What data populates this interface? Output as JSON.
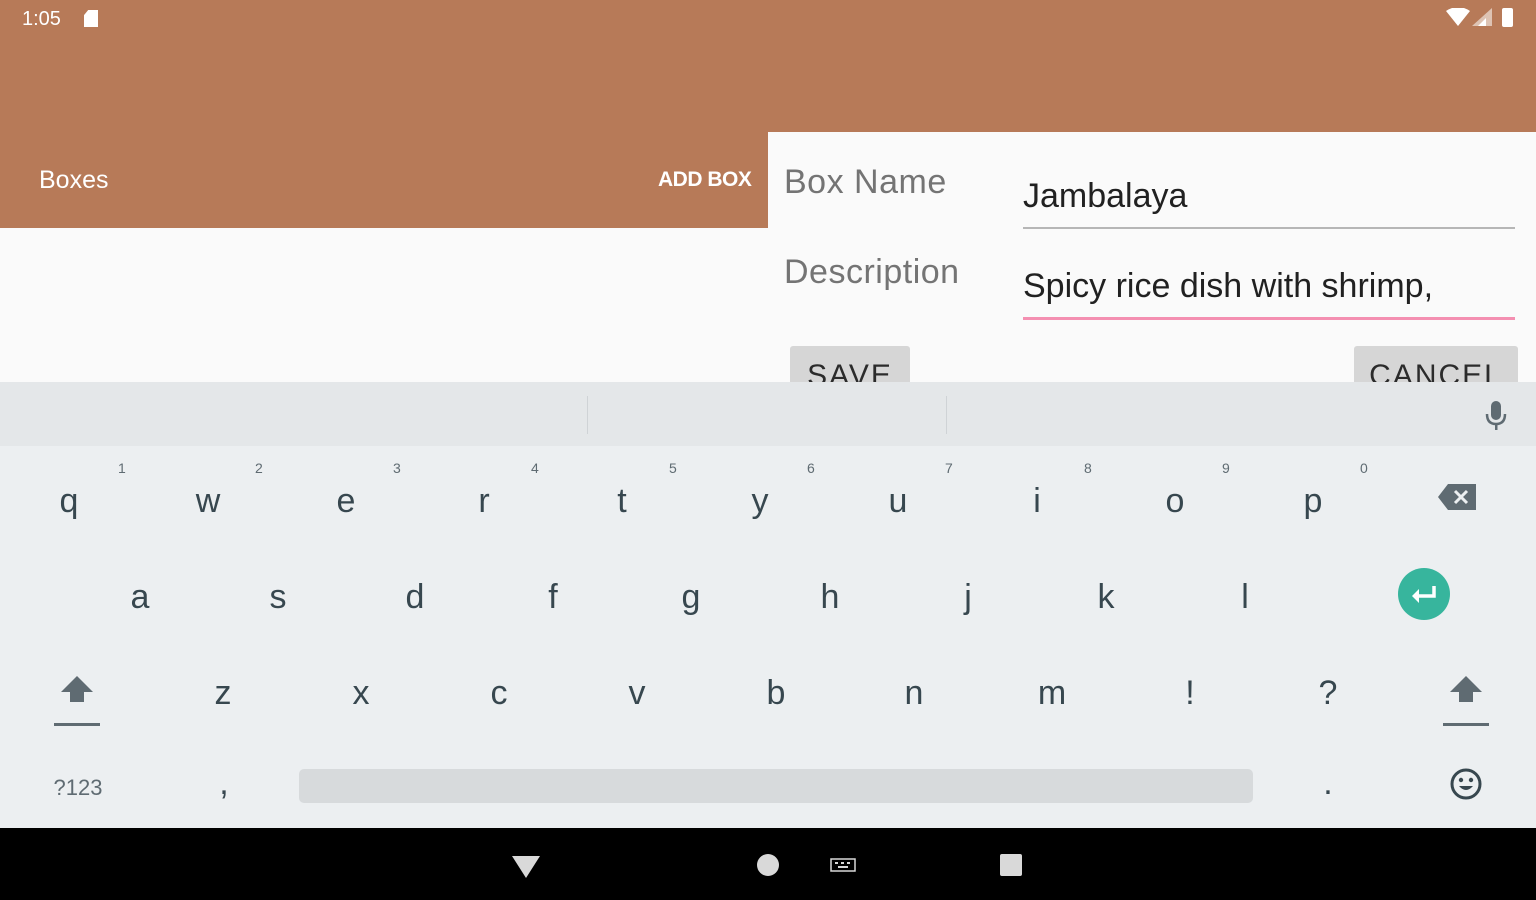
{
  "status_bar": {
    "time": "1:05",
    "icons": [
      "sd-card-icon",
      "wifi-icon",
      "signal-icon",
      "battery-icon"
    ]
  },
  "toolbar": {
    "title": "Boxes",
    "add_box_label": "ADD BOX",
    "color": "#b77a58"
  },
  "dialog": {
    "name_label": "Box Name",
    "name_value": "Jambalaya",
    "description_label": "Description",
    "description_value": "Spicy rice dish with shrimp,",
    "save_label": "SAVE",
    "cancel_label": "CANCEL",
    "active_underline_color": "#f48fb1"
  },
  "keyboard": {
    "row1": [
      "q",
      "w",
      "e",
      "r",
      "t",
      "y",
      "u",
      "i",
      "o",
      "p"
    ],
    "row1_hints": [
      "1",
      "2",
      "3",
      "4",
      "5",
      "6",
      "7",
      "8",
      "9",
      "0"
    ],
    "row2": [
      "a",
      "s",
      "d",
      "f",
      "g",
      "h",
      "j",
      "k",
      "l"
    ],
    "row3": [
      "z",
      "x",
      "c",
      "v",
      "b",
      "n",
      "m",
      "!",
      "?"
    ],
    "symbols_label": "?123",
    "comma_label": ",",
    "period_label": ".",
    "enter_color": "#37b59d",
    "icons": [
      "mic-icon",
      "backspace-icon",
      "enter-icon",
      "shift-icon",
      "emoji-icon"
    ]
  },
  "nav_bar": {
    "icons": [
      "back-icon",
      "home-icon",
      "keyboard-switch-icon",
      "recents-icon"
    ]
  }
}
